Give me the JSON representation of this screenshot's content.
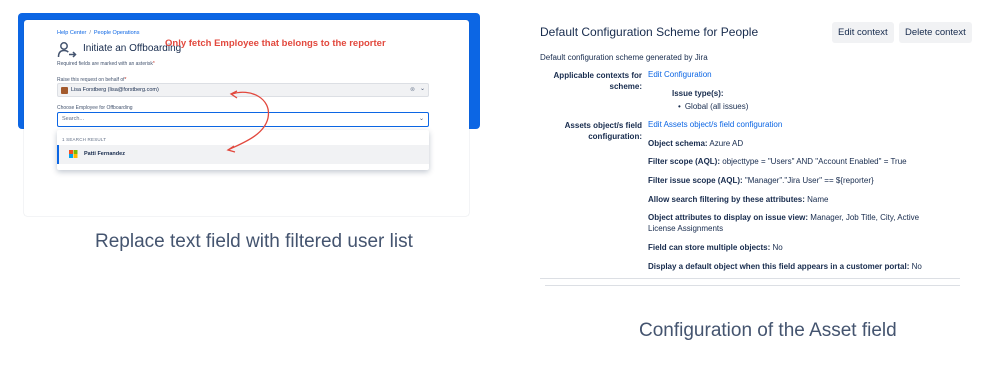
{
  "left": {
    "breadcrumb": [
      "Help Center",
      "People Operations"
    ],
    "breadcrumb_sep": "/",
    "form_title": "Initiate an Offboarding",
    "required_note": "Required fields are marked with an asterisk",
    "required_star": "*",
    "annotation": "Only fetch Employee that belongs to the reporter",
    "raise_label": "Raise this request on behalf of",
    "raise_value": "Lisa Forstberg (lisa@forstberg.com)",
    "employee_label": "Choose Employee for Offboarding",
    "employee_placeholder": "Search...",
    "dropdown_header": "1 SEARCH RESULT",
    "result_name": "Patti Fernandez",
    "caption": "Replace text field with filtered user list",
    "icons": {
      "service": "person-arrow-icon",
      "clear": "clear-icon",
      "chevron": "chevron-down-icon"
    },
    "annotation_color": "#e2483d",
    "accent": "#0c66e4"
  },
  "right": {
    "title": "Default Configuration Scheme for People",
    "edit_context": "Edit context",
    "delete_context": "Delete context",
    "description": "Default configuration scheme generated by Jira",
    "applicable_label": "Applicable contexts for scheme:",
    "edit_configuration": "Edit Configuration",
    "issue_types_label": "Issue type(s):",
    "issue_type_value": "Global (all issues)",
    "assets_label": "Assets object/s field configuration:",
    "edit_assets": "Edit Assets object/s field configuration",
    "attributes": [
      {
        "key": "Object schema:",
        "value": "Azure AD"
      },
      {
        "key": "Filter scope (AQL):",
        "value": "objecttype = \"Users\" AND \"Account Enabled\" = True"
      },
      {
        "key": "Filter issue scope (AQL):",
        "value": "\"Manager\".\"Jira User\" == ${reporter}"
      },
      {
        "key": "Allow search filtering by these attributes:",
        "value": "Name"
      },
      {
        "key": "Object attributes to display on issue view:",
        "value": "Manager, Job Title, City, Active License Assignments"
      },
      {
        "key": "Field can store multiple objects:",
        "value": "No"
      },
      {
        "key": "Display a default object when this field appears in a customer portal:",
        "value": "No"
      }
    ],
    "caption": "Configuration of the Asset field"
  }
}
